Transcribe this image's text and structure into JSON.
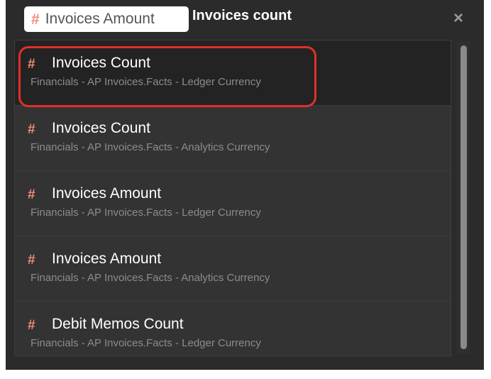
{
  "search": {
    "token_label": "Invoices Amount",
    "typed_text": "Invoices count",
    "close_symbol": "×"
  },
  "icons": {
    "measure_icon": "#",
    "close_icon": "close-icon"
  },
  "results": [
    {
      "title": "Invoices Count",
      "subtitle": "Financials - AP Invoices.Facts - Ledger Currency",
      "selected": true
    },
    {
      "title": "Invoices Count",
      "subtitle": "Financials - AP Invoices.Facts - Analytics Currency",
      "selected": false
    },
    {
      "title": "Invoices Amount",
      "subtitle": "Financials - AP Invoices.Facts - Ledger Currency",
      "selected": false
    },
    {
      "title": "Invoices Amount",
      "subtitle": "Financials - AP Invoices.Facts - Analytics Currency",
      "selected": false
    },
    {
      "title": "Debit Memos Count",
      "subtitle": "Financials - AP Invoices.Facts - Ledger Currency",
      "selected": false
    }
  ],
  "colors": {
    "panel_bg": "#2b2b2b",
    "list_bg": "#333333",
    "selected_bg": "#232323",
    "accent_hash": "#f28b77",
    "highlight_border": "#e0302b"
  }
}
